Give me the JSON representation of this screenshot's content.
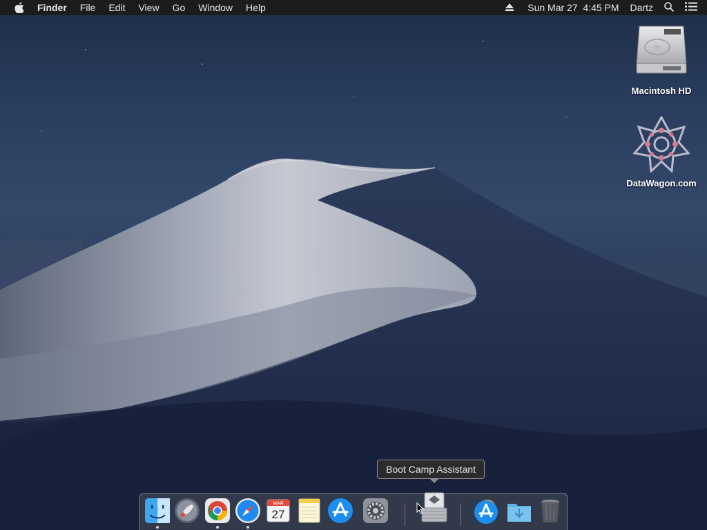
{
  "menubar": {
    "apple_icon": "apple-icon",
    "app_name": "Finder",
    "menus": [
      "File",
      "Edit",
      "View",
      "Go",
      "Window",
      "Help"
    ],
    "eject_icon": "eject-icon",
    "datetime": "Sun Mar 27  4:45 PM",
    "user": "Dartz",
    "search_icon": "spotlight-search-icon",
    "notification_icon": "notification-center-icon"
  },
  "desktop_icons": [
    {
      "label": "Macintosh HD",
      "icon": "hard-drive-icon"
    },
    {
      "label": "DataWagon.com",
      "icon": "network-volume-icon"
    }
  ],
  "tooltip": {
    "text": "Boot Camp Assistant"
  },
  "dock": {
    "apps": [
      {
        "name": "Finder",
        "icon": "finder-icon",
        "running": true
      },
      {
        "name": "Launchpad",
        "icon": "launchpad-icon",
        "running": false
      },
      {
        "name": "Google Chrome",
        "icon": "chrome-icon",
        "running": true
      },
      {
        "name": "Safari",
        "icon": "safari-icon",
        "running": true
      },
      {
        "name": "Calendar",
        "icon": "calendar-icon",
        "running": false,
        "month": "MAR",
        "day": "27"
      },
      {
        "name": "Notes",
        "icon": "notes-icon",
        "running": false
      },
      {
        "name": "App Store",
        "icon": "app-store-icon",
        "running": false
      },
      {
        "name": "System Preferences",
        "icon": "system-preferences-icon",
        "running": false
      },
      {
        "name": "Boot Camp Assistant",
        "icon": "boot-camp-icon",
        "running": false
      }
    ],
    "others": [
      {
        "name": "Applications",
        "icon": "applications-folder-icon"
      },
      {
        "name": "Downloads",
        "icon": "downloads-folder-icon"
      },
      {
        "name": "Trash",
        "icon": "trash-icon"
      }
    ]
  },
  "colors": {
    "menubar_bg": "#1c1c1e",
    "dock_bg": "#3c4252",
    "wallpaper_sky": "#2a3d5e",
    "dune_highlight": "#c9ccd6"
  }
}
